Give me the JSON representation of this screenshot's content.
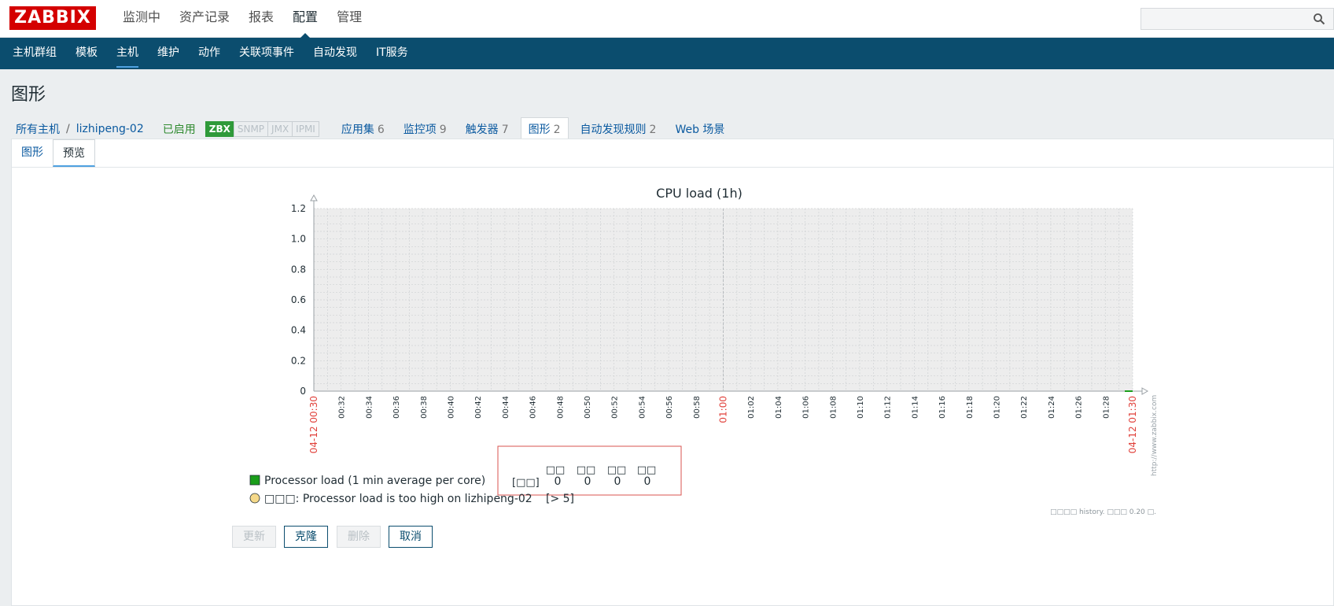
{
  "header": {
    "logo": "ZABBIX",
    "nav": [
      "监测中",
      "资产记录",
      "报表",
      "配置",
      "管理"
    ],
    "active_nav": "配置"
  },
  "subnav": {
    "items": [
      "主机群组",
      "模板",
      "主机",
      "维护",
      "动作",
      "关联项事件",
      "自动发现",
      "IT服务"
    ],
    "active": "主机"
  },
  "page": {
    "title": "图形"
  },
  "hostbar": {
    "all_hosts": "所有主机",
    "separator": "/",
    "host": "lizhipeng-02",
    "status": "已启用",
    "badges": [
      "ZBX",
      "SNMP",
      "JMX",
      "IPMI"
    ],
    "tabs": [
      {
        "label": "应用集",
        "count": "6"
      },
      {
        "label": "监控项",
        "count": "9"
      },
      {
        "label": "触发器",
        "count": "7"
      },
      {
        "label": "图形",
        "count": "2"
      },
      {
        "label": "自动发现规则",
        "count": "2"
      },
      {
        "label": "Web 场景",
        "count": ""
      }
    ],
    "active_tab": "图形"
  },
  "tabs": {
    "items": [
      "图形",
      "预览"
    ],
    "active": "预览"
  },
  "chart_data": {
    "type": "line",
    "title": "CPU load (1h)",
    "y_ticks": [
      "1.2",
      "1.0",
      "0.8",
      "0.6",
      "0.4",
      "0.2",
      "0"
    ],
    "ylim": [
      0,
      1.2
    ],
    "x_ticks": [
      "00:32",
      "00:34",
      "00:36",
      "00:38",
      "00:40",
      "00:42",
      "00:44",
      "00:46",
      "00:48",
      "00:50",
      "00:52",
      "00:54",
      "00:56",
      "00:58",
      "01:00",
      "01:02",
      "01:04",
      "01:06",
      "01:08",
      "01:10",
      "01:12",
      "01:14",
      "01:16",
      "01:18",
      "01:20",
      "01:22",
      "01:24",
      "01:26",
      "01:28"
    ],
    "x_start_label": "04-12 00:30",
    "x_end_label": "04-12 01:30",
    "grid": true,
    "watermark": "http://www.zabbix.com",
    "series": [
      {
        "name": "Processor load (1 min average per core)",
        "color": "#1a9e1a",
        "values": [
          0
        ]
      }
    ],
    "legend": {
      "item_label": "Processor load (1 min average per core)",
      "item_func": "[□□]",
      "stat_headers": [
        "□□",
        "□□",
        "□□",
        "□□"
      ],
      "stat_values": [
        "0",
        "0",
        "0",
        "0"
      ],
      "trigger_label": "□□□: Processor load is too high on lizhipeng-02",
      "trigger_value": "[> 5]",
      "trigger_color": "#f5d98a"
    },
    "footer_note": "□□□□ history. □□□ 0.20 □."
  },
  "buttons": {
    "update": "更新",
    "clone": "克隆",
    "delete": "删除",
    "cancel": "取消"
  }
}
